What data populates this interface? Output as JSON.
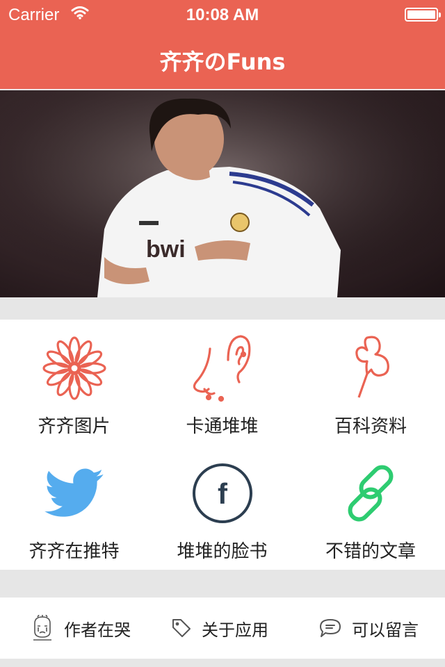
{
  "status": {
    "carrier": "Carrier",
    "time": "10:08 AM"
  },
  "nav": {
    "title": "齐齐のFuns"
  },
  "grid": {
    "items": [
      {
        "label": "齐齐图片",
        "icon": "flower-icon"
      },
      {
        "label": "卡通堆堆",
        "icon": "ear-nose-icon"
      },
      {
        "label": "百科资料",
        "icon": "pushpin-icon"
      },
      {
        "label": "齐齐在推特",
        "icon": "twitter-icon"
      },
      {
        "label": "堆堆的脸书",
        "icon": "facebook-icon"
      },
      {
        "label": "不错的文章",
        "icon": "link-icon"
      }
    ]
  },
  "bottom": {
    "items": [
      {
        "label": "作者在哭",
        "icon": "crying-avatar-icon"
      },
      {
        "label": "关于应用",
        "icon": "tag-icon"
      },
      {
        "label": "可以留言",
        "icon": "speech-bubble-icon"
      }
    ]
  },
  "colors": {
    "accent": "#ea6353",
    "twitter": "#55acee",
    "facebook": "#2c3e50",
    "link": "#2ecc71"
  }
}
